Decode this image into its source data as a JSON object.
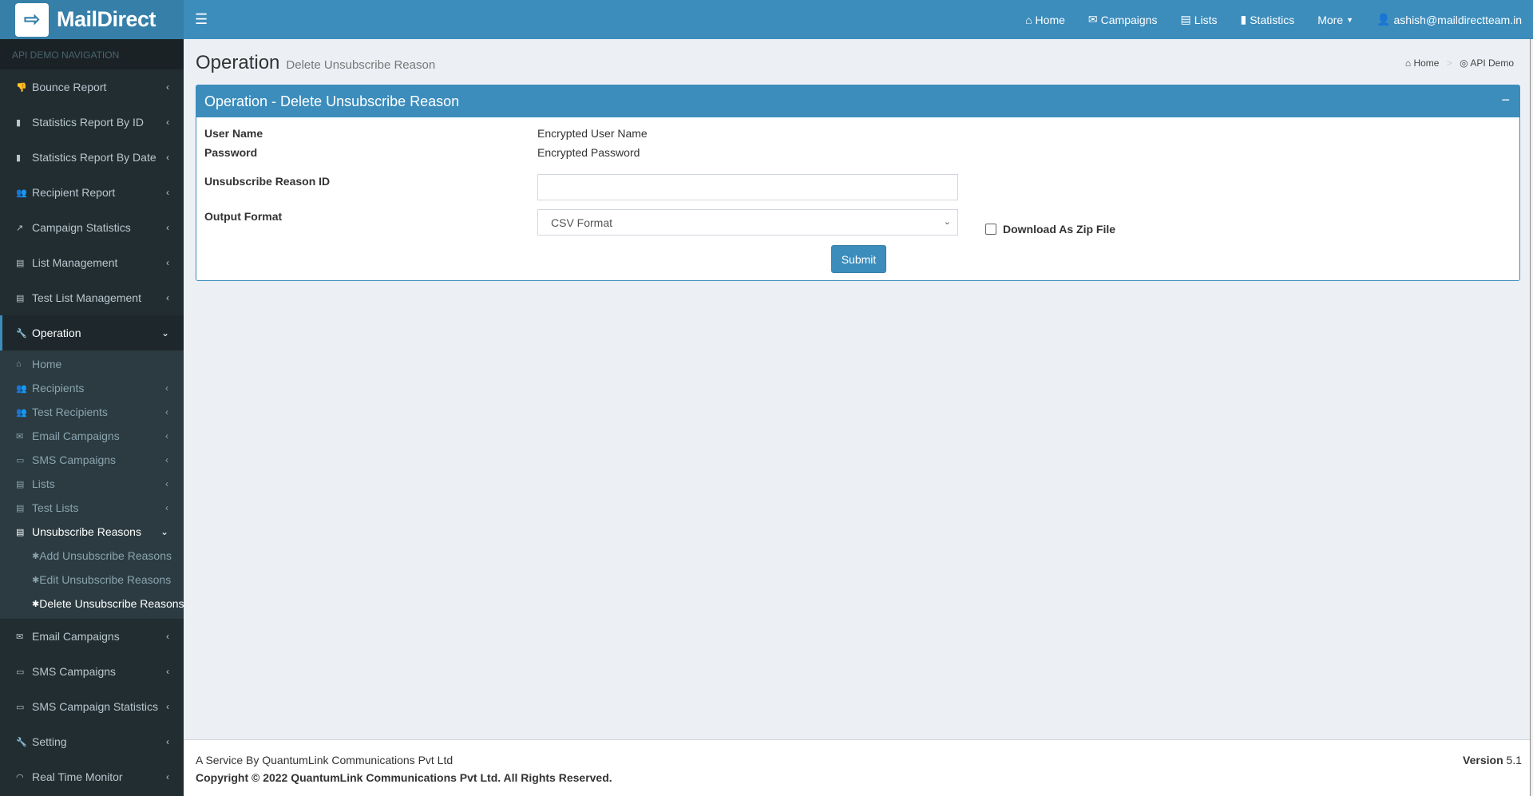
{
  "brand": {
    "name": "MailDirect"
  },
  "topnav": {
    "items": [
      "Home",
      "Campaigns",
      "Lists",
      "Statistics",
      "More"
    ],
    "user": "ashish@maildirectteam.in"
  },
  "sidebar": {
    "header": "API DEMO NAVIGATION",
    "items_top": [
      "Bounce Report",
      "Statistics Report By ID",
      "Statistics Report By Date",
      "Recipient Report",
      "Campaign Statistics",
      "List Management",
      "Test List Management"
    ],
    "active": "Operation",
    "sub": [
      "Home",
      "Recipients",
      "Test Recipients",
      "Email Campaigns",
      "SMS Campaigns",
      "Lists",
      "Test Lists"
    ],
    "sub_open": "Unsubscribe Reasons",
    "sub2": [
      "Add Unsubscribe Reasons",
      "Edit Unsubscribe Reasons",
      "Delete Unsubscribe Reasons"
    ],
    "items_bottom": [
      "Email Campaigns",
      "SMS Campaigns",
      "SMS Campaign Statistics",
      "Setting",
      "Real Time Monitor"
    ]
  },
  "page": {
    "title": "Operation",
    "subtitle": "Delete Unsubscribe Reason",
    "breadcrumb": [
      "Home",
      "API Demo"
    ]
  },
  "box": {
    "title": "Operation - Delete Unsubscribe Reason",
    "user_label": "User Name",
    "user_value": "Encrypted User Name",
    "pass_label": "Password",
    "pass_value": "Encrypted Password",
    "id_label": "Unsubscribe Reason ID",
    "id_value": "",
    "format_label": "Output Format",
    "format_value": "CSV Format",
    "zip_label": "Download As Zip File",
    "zip_checked": false,
    "submit": "Submit"
  },
  "footer": {
    "line1": "A Service By QuantumLink Communications Pvt Ltd",
    "line2": "Copyright © 2022 QuantumLink Communications Pvt Ltd. All Rights Reserved.",
    "version_label": "Version",
    "version": "5.1"
  },
  "colors": {
    "primary": "#3c8dbc",
    "sidebar": "#222d32"
  }
}
